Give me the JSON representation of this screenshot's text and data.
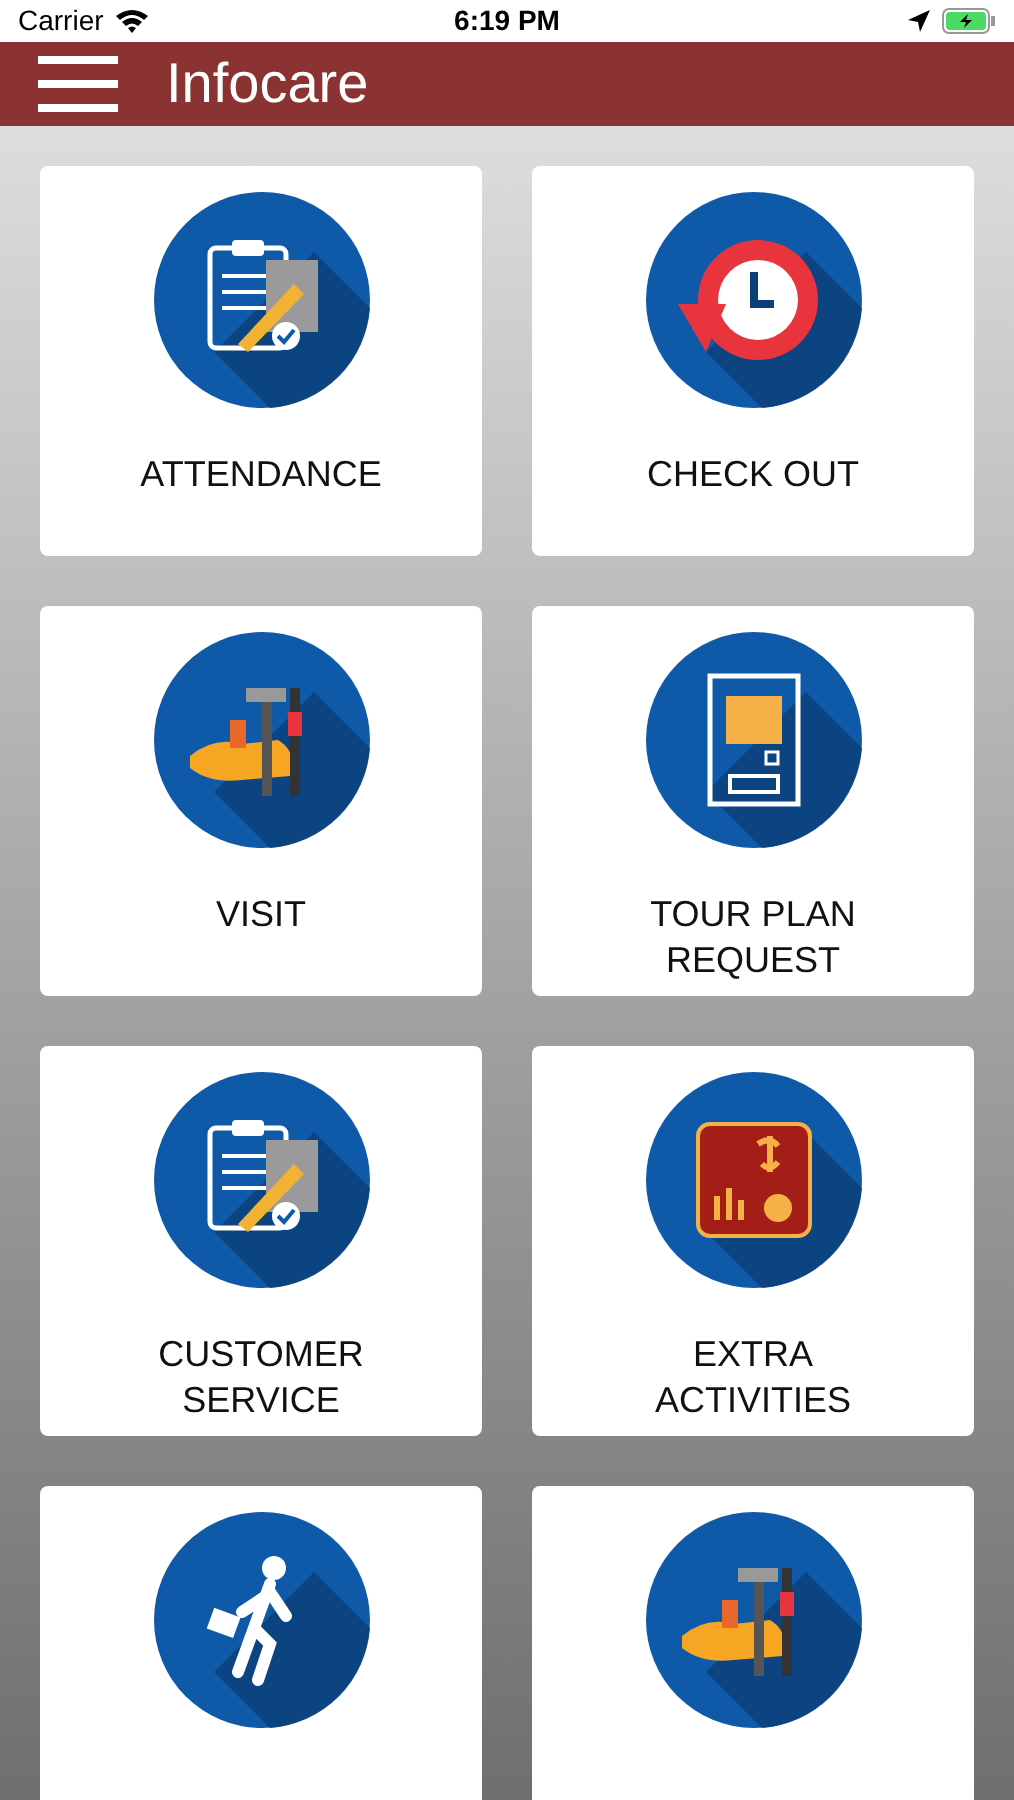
{
  "status_bar": {
    "carrier": "Carrier",
    "time": "6:19 PM"
  },
  "header": {
    "title": "Infocare"
  },
  "tiles": [
    {
      "kind": "clipboard",
      "label": "ATTENDANCE"
    },
    {
      "kind": "clock",
      "label": "CHECK OUT"
    },
    {
      "kind": "tools",
      "label": "VISIT"
    },
    {
      "kind": "kiosk",
      "label": "TOUR PLAN REQUEST"
    },
    {
      "kind": "clipboard",
      "label": "CUSTOMER SERVICE"
    },
    {
      "kind": "chart",
      "label": "EXTRA ACTIVITIES"
    },
    {
      "kind": "walker"
    },
    {
      "kind": "tools"
    }
  ]
}
